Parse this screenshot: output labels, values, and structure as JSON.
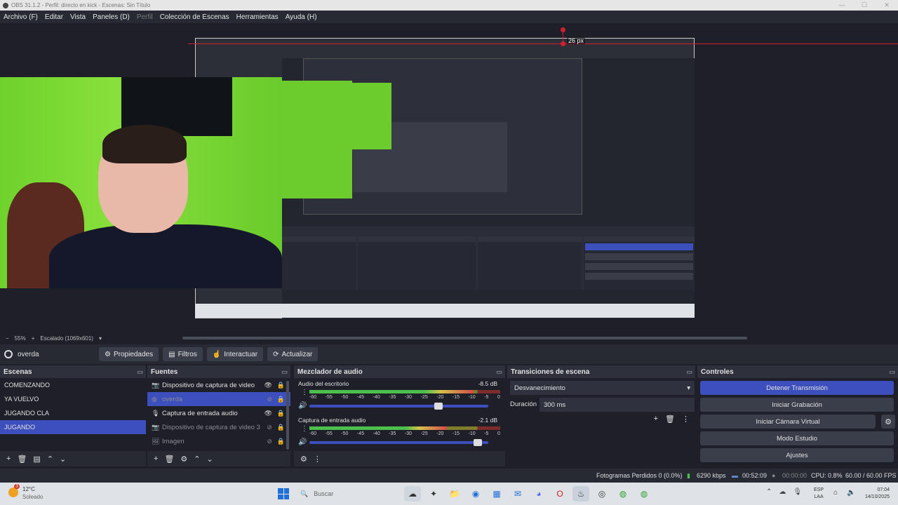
{
  "window": {
    "title": "OBS 31.1.2 - Perfil: directo en kick - Escenas: Sin Título",
    "controls": [
      "—",
      "☐",
      "✕"
    ]
  },
  "menu": [
    {
      "label": "Archivo (F)",
      "disabled": false
    },
    {
      "label": "Editar",
      "disabled": false
    },
    {
      "label": "Vista",
      "disabled": false
    },
    {
      "label": "Paneles (D)",
      "disabled": false
    },
    {
      "label": "Perfil",
      "disabled": true
    },
    {
      "label": "Colección de Escenas",
      "disabled": false
    },
    {
      "label": "Herramientas",
      "disabled": false
    },
    {
      "label": "Ayuda (H)",
      "disabled": false
    }
  ],
  "preview": {
    "guide_label": "26 px",
    "zoom": "55%",
    "scale_mode": "Escalado (1069x601)"
  },
  "source_bar": {
    "selected_source": "overda",
    "buttons": [
      {
        "label": "Propiedades",
        "icon": "gear-icon"
      },
      {
        "label": "Filtros",
        "icon": "filter-icon"
      },
      {
        "label": "Interactuar",
        "icon": "pointer-icon"
      },
      {
        "label": "Actualizar",
        "icon": "refresh-icon"
      }
    ]
  },
  "scenes": {
    "title": "Escenas",
    "items": [
      {
        "label": "COMENZANDO",
        "selected": false
      },
      {
        "label": "YA VUELVO",
        "selected": false
      },
      {
        "label": "JUGANDO CLA",
        "selected": false
      },
      {
        "label": "JUGANDO",
        "selected": true
      }
    ]
  },
  "sources": {
    "title": "Fuentes",
    "items": [
      {
        "label": "Dispositivo de captura de video",
        "icon": "camera-icon",
        "visible": true,
        "selected": false
      },
      {
        "label": "overda",
        "icon": "browser-icon",
        "visible": false,
        "selected": true
      },
      {
        "label": "Captura de entrada audio",
        "icon": "mic-icon",
        "visible": true,
        "selected": false
      },
      {
        "label": "Dispositivo de captura de video 3",
        "icon": "camera-icon",
        "visible": false,
        "selected": false
      },
      {
        "label": "Imagen",
        "icon": "image-icon",
        "visible": false,
        "selected": false
      }
    ]
  },
  "mixer": {
    "title": "Mezclador de audio",
    "ticks": [
      "-60",
      "-55",
      "-50",
      "-45",
      "-40",
      "-35",
      "-30",
      "-25",
      "-20",
      "-15",
      "-10",
      "-5",
      "0"
    ],
    "channels": [
      {
        "name": "Audio del escritorio",
        "db": "-8.5 dB",
        "level": 0.86,
        "volume": 0.72
      },
      {
        "name": "Captura de entrada audio",
        "db": "-2.1 dB",
        "level": 0.72,
        "volume": 0.94
      }
    ]
  },
  "transitions": {
    "title": "Transiciones de escena",
    "selected": "Desvanecimiento",
    "duration_label": "Duración",
    "duration": "300 ms"
  },
  "controls": {
    "title": "Controles",
    "buttons": [
      {
        "label": "Detener Transmisión",
        "active": true
      },
      {
        "label": "Iniciar Grabación",
        "active": false
      },
      {
        "label": "Iniciar Cámara Virtual",
        "active": false
      },
      {
        "label": "Modo Estudio",
        "active": false
      },
      {
        "label": "Ajustes",
        "active": false
      }
    ]
  },
  "status": {
    "dropped_frames": "Fotogramas Perdidos 0 (0.0%)",
    "bitrate": "6290 kbps",
    "stream_time": "00:52:09",
    "rec_time": "00:00:00",
    "cpu": "CPU: 0.8%",
    "fps": "60.00 / 60.00 FPS"
  },
  "taskbar": {
    "weather_badge": "3",
    "temperature": "12°C",
    "condition": "Soleado",
    "search_placeholder": "Buscar",
    "language_top": "ESP",
    "language_bottom": "LAA",
    "time": "07:04",
    "date": "14/10/2025"
  },
  "colors": {
    "accent": "#3d4fbd",
    "guide": "#d02030",
    "background": "#1e1f29",
    "panel": "#272a33"
  }
}
